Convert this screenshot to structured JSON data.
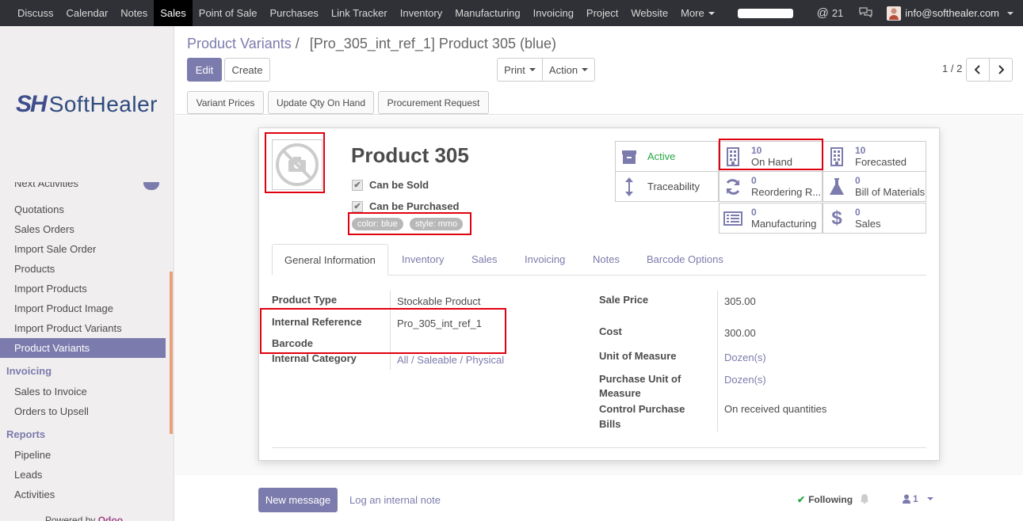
{
  "topbar": {
    "menu": [
      "Discuss",
      "Calendar",
      "Notes",
      "Sales",
      "Point of Sale",
      "Purchases",
      "Link Tracker",
      "Inventory",
      "Manufacturing",
      "Invoicing",
      "Project",
      "Website",
      "More"
    ],
    "active_menu": "Sales",
    "mentions_count": "21",
    "user": "info@softhealer.com"
  },
  "sidebar": {
    "logo_mark": "SH",
    "logo_text": "SoftHealer",
    "partial_top": "Next Activities",
    "items_sales": [
      "Quotations",
      "Sales Orders",
      "Import Sale Order",
      "Products",
      "Import Products",
      "Import Product Image",
      "Import Product Variants",
      "Product Variants"
    ],
    "active_item": "Product Variants",
    "header_invoicing": "Invoicing",
    "items_invoicing": [
      "Sales to Invoice",
      "Orders to Upsell"
    ],
    "header_reports": "Reports",
    "items_reports": [
      "Pipeline",
      "Leads",
      "Activities"
    ],
    "powered_by": "Powered by",
    "powered_brand": "Odoo"
  },
  "controlpanel": {
    "breadcrumb_parent": "Product Variants",
    "breadcrumb_sep": "/",
    "breadcrumb_current": "[Pro_305_int_ref_1] Product 305 (blue)",
    "edit": "Edit",
    "create": "Create",
    "print": "Print",
    "action": "Action",
    "pager": "1 / 2",
    "header_buttons": [
      "Variant Prices",
      "Update Qty On Hand",
      "Procurement Request"
    ]
  },
  "product": {
    "name": "Product 305",
    "can_be_sold": "Can be Sold",
    "can_be_purchased": "Can be Purchased",
    "tags": [
      "color: blue",
      "style: mmo"
    ]
  },
  "smart_buttons": {
    "active": "Active",
    "traceability": "Traceability",
    "on_hand_num": "10",
    "on_hand_label": "On Hand",
    "forecasted_num": "10",
    "forecasted_label": "Forecasted",
    "reordering_num": "0",
    "reordering_label": "Reordering R...",
    "bom_num": "0",
    "bom_label": "Bill of Materials",
    "manufacturing_num": "0",
    "manufacturing_label": "Manufacturing",
    "sales_num": "0",
    "sales_label": "Sales"
  },
  "tabs": [
    "General Information",
    "Inventory",
    "Sales",
    "Invoicing",
    "Notes",
    "Barcode Options"
  ],
  "fields": {
    "product_type_label": "Product Type",
    "product_type": "Stockable Product",
    "internal_ref_label": "Internal Reference",
    "internal_ref": "Pro_305_int_ref_1",
    "barcode_label": "Barcode",
    "internal_category_label": "Internal Category",
    "internal_category": "All / Saleable / Physical",
    "sale_price_label": "Sale Price",
    "sale_price": "305.00",
    "cost_label": "Cost",
    "cost": "300.00",
    "uom_label": "Unit of Measure",
    "uom": "Dozen(s)",
    "purchase_uom_label_1": "Purchase Unit of",
    "purchase_uom_label_2": "Measure",
    "purchase_uom": "Dozen(s)",
    "control_label_1": "Control Purchase",
    "control_label_2": "Bills",
    "control": "On received quantities"
  },
  "chatter": {
    "new_message": "New message",
    "log_note": "Log an internal note",
    "following": "Following",
    "followers": "1"
  },
  "colors": {
    "accent": "#7c7bad",
    "highlight": "#e0000f",
    "topbar": "#2f3136"
  }
}
